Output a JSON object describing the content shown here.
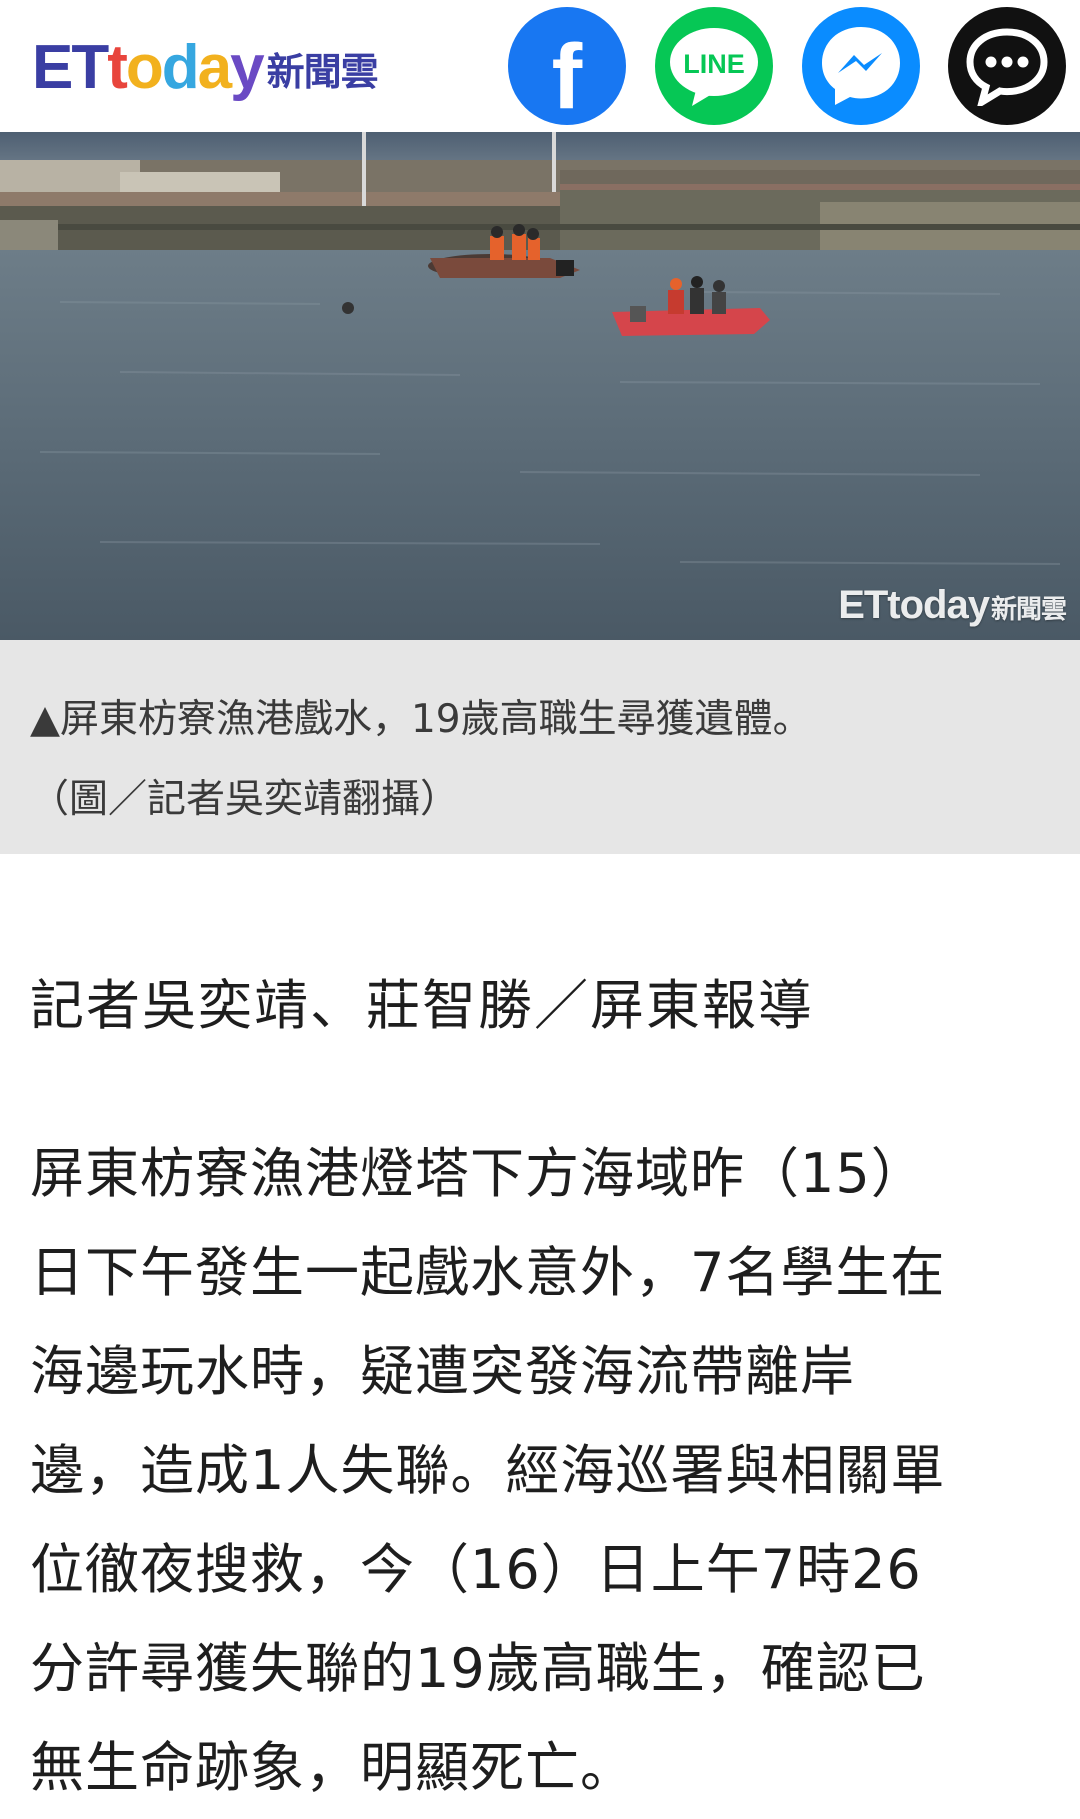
{
  "header": {
    "logo_text": "ETtoday",
    "logo_sub": "新聞雲",
    "share_buttons": [
      {
        "name": "facebook",
        "icon": "facebook-icon",
        "color": "#1877f2"
      },
      {
        "name": "line",
        "label": "LINE",
        "icon": "line-icon",
        "color": "#06c755"
      },
      {
        "name": "messenger",
        "icon": "messenger-icon",
        "color": "#0a8cff"
      },
      {
        "name": "more",
        "icon": "chat-bubble-icon",
        "color": "#111111"
      }
    ]
  },
  "photo": {
    "watermark": "ETtoday",
    "watermark_sub": "新聞雲"
  },
  "caption": {
    "line1": "▲屏東枋寮漁港戲水，19歲高職生尋獲遺體。",
    "line2": "（圖／記者吳奕靖翻攝）"
  },
  "article": {
    "byline": "記者吳奕靖、莊智勝／屏東報導",
    "body_lines": [
      "屏東枋寮漁港燈塔下方海域昨（15）",
      "日下午發生一起戲水意外，7名學生在",
      "海邊玩水時，疑遭突發海流帶離岸",
      "邊，造成1人失聯。經海巡署與相關單",
      "位徹夜搜救，今（16）日上午7時26",
      "分許尋獲失聯的19歲高職生，確認已",
      "無生命跡象，明顯死亡。"
    ]
  }
}
